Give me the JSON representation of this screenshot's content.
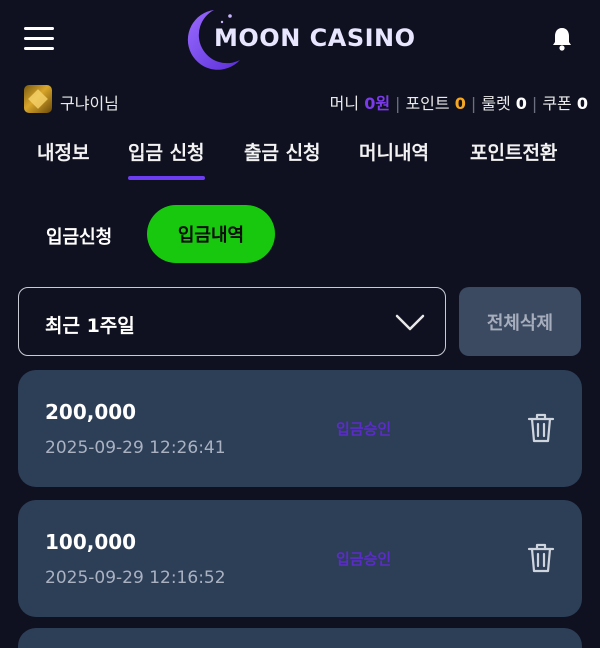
{
  "header": {
    "logo_text": "MOON CASINO",
    "menu_icon": "hamburger-menu-icon",
    "notify_icon": "bell-icon"
  },
  "user": {
    "name": "구냐이님",
    "stats": [
      {
        "label": "머니",
        "value": "0원",
        "color": "#7c3aed"
      },
      {
        "label": "포인트",
        "value": "0",
        "color": "#f5a623"
      },
      {
        "label": "룰렛",
        "value": "0",
        "color": "#ffffff"
      },
      {
        "label": "쿠폰",
        "value": "0",
        "color": "#ffffff"
      }
    ]
  },
  "tabs": [
    "내정보",
    "입금 신청",
    "출금 신청",
    "머니내역",
    "포인트전환"
  ],
  "active_tab": "입금 신청",
  "subtabs": {
    "request": "입금신청",
    "history": "입금내역"
  },
  "filter": {
    "period": "최근 1주일",
    "delete_all": "전체삭제"
  },
  "transactions": [
    {
      "amount": "200,000",
      "datetime": "2025-09-29 12:26:41",
      "status": "입금승인"
    },
    {
      "amount": "100,000",
      "datetime": "2025-09-29 12:16:52",
      "status": "입금승인"
    }
  ],
  "colors": {
    "background": "#0f1120",
    "accent_purple": "#6d3df2",
    "accent_green": "#18c80e",
    "card": "#2d3e57"
  }
}
